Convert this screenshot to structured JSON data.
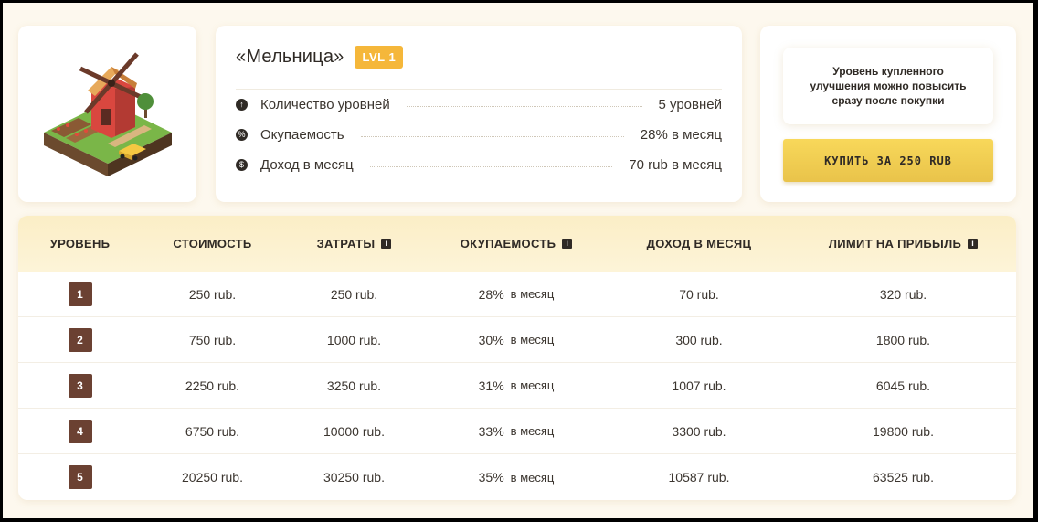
{
  "product": {
    "title": "«Мельница»",
    "level_badge": "LVL 1",
    "image_icon": "windmill-icon"
  },
  "info": [
    {
      "label": "Количество уровней",
      "value": "5 уровней",
      "icon": "arrow-up-icon"
    },
    {
      "label": "Окупаемость",
      "value": "28% в месяц",
      "icon": "percent-icon"
    },
    {
      "label": "Доход в месяц",
      "value": "70 rub в месяц",
      "icon": "coin-icon"
    }
  ],
  "buy": {
    "note": "Уровень купленного улучшения можно повысить сразу после покупки",
    "button_label": "КУПИТЬ ЗА 250 RUB"
  },
  "table": {
    "headers": [
      "УРОВЕНЬ",
      "СТОИМОСТЬ",
      "ЗАТРАТЫ",
      "ОКУПАЕМОСТЬ",
      "ДОХОД В МЕСЯЦ",
      "ЛИМИТ НА ПРИБЫЛЬ"
    ],
    "rows": [
      {
        "level": "1",
        "cost": "250 rub.",
        "expenses": "250 rub.",
        "payback": "28%",
        "payback_unit": "в месяц",
        "income": "70 rub.",
        "limit": "320 rub."
      },
      {
        "level": "2",
        "cost": "750 rub.",
        "expenses": "1000 rub.",
        "payback": "30%",
        "payback_unit": "в месяц",
        "income": "300 rub.",
        "limit": "1800 rub."
      },
      {
        "level": "3",
        "cost": "2250 rub.",
        "expenses": "3250 rub.",
        "payback": "31%",
        "payback_unit": "в месяц",
        "income": "1007 rub.",
        "limit": "6045 rub."
      },
      {
        "level": "4",
        "cost": "6750 rub.",
        "expenses": "10000 rub.",
        "payback": "33%",
        "payback_unit": "в месяц",
        "income": "3300 rub.",
        "limit": "19800 rub."
      },
      {
        "level": "5",
        "cost": "20250 rub.",
        "expenses": "30250 rub.",
        "payback": "35%",
        "payback_unit": "в месяц",
        "income": "10587 rub.",
        "limit": "63525 rub."
      }
    ]
  }
}
